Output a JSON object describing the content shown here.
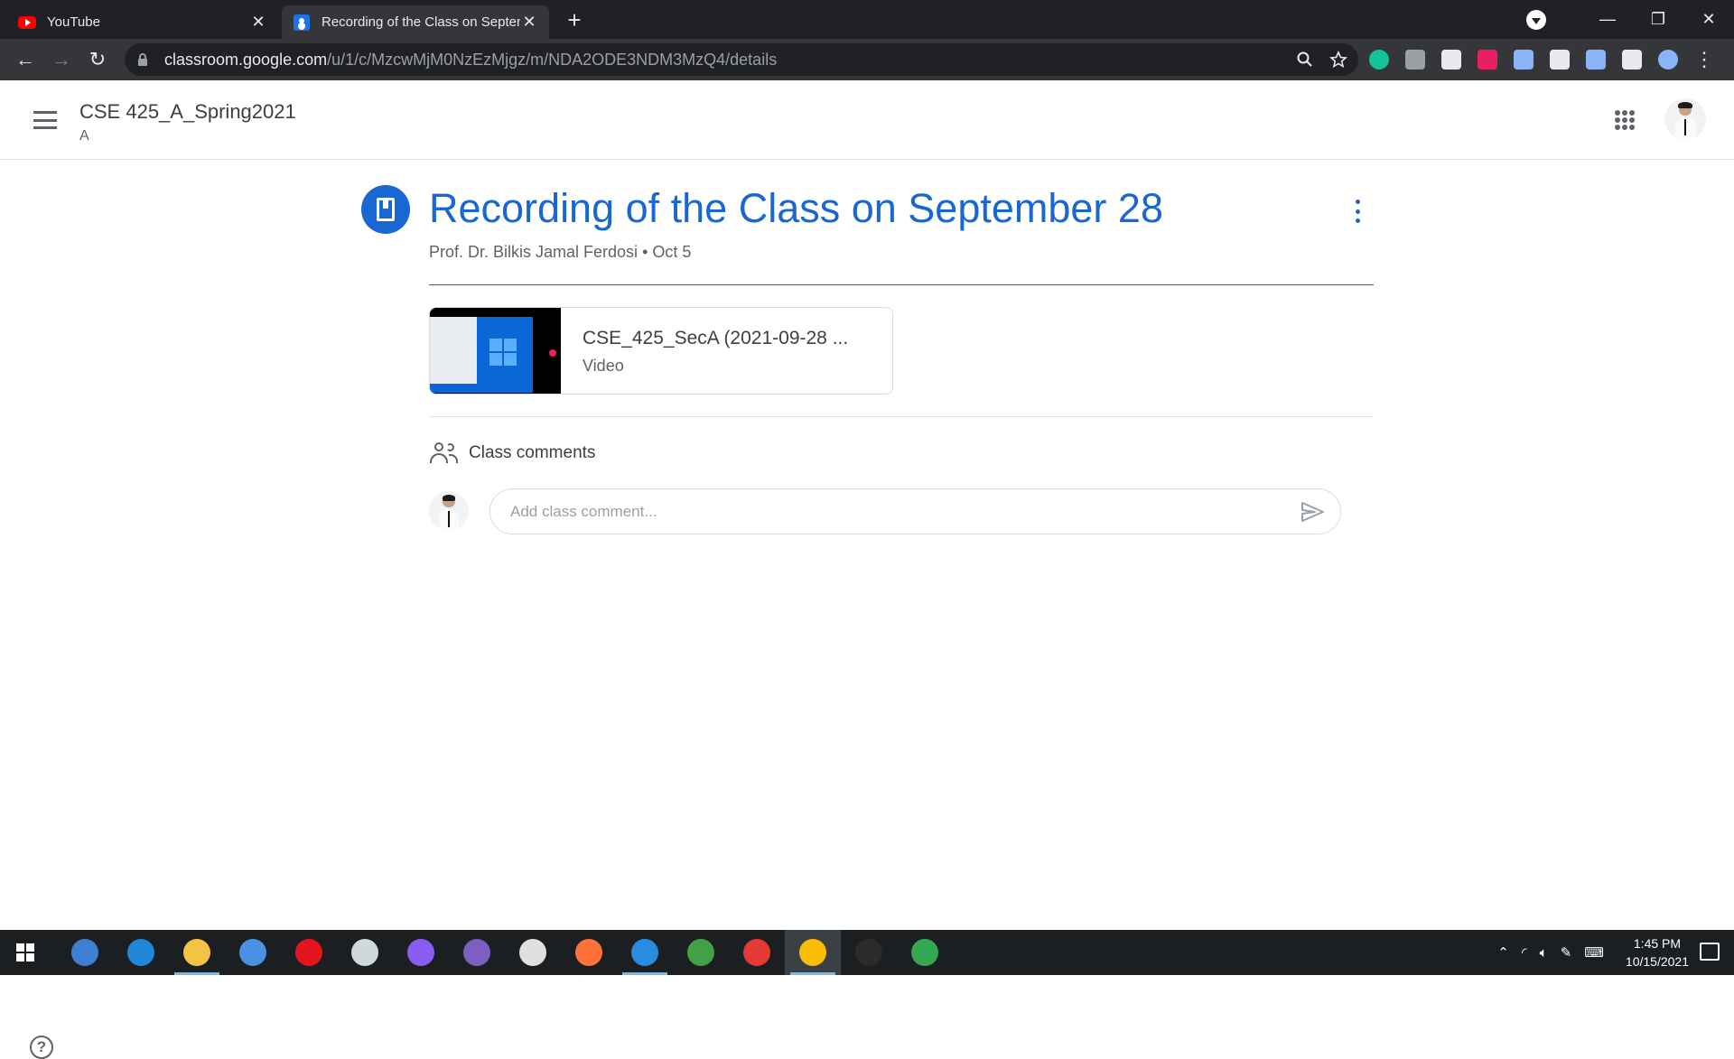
{
  "browser": {
    "tabs": [
      {
        "title": "YouTube",
        "active": false,
        "icon": "youtube-icon"
      },
      {
        "title": "Recording of the Class on Septem",
        "active": true,
        "icon": "google-classroom-icon"
      }
    ],
    "url_host": "classroom.google.com",
    "url_path": "/u/1/c/MzcwMjM0NzEzMjgz/m/NDA2ODE3NDM3MzQ4/details",
    "extension_colors": [
      "#15c39a",
      "#9aa0a6",
      "#e8eaed",
      "#e91e63",
      "#8ab4f8",
      "#e8eaed",
      "#8ab4f8",
      "#e8eaed"
    ]
  },
  "classroom": {
    "course_name": "CSE 425_A_Spring2021",
    "course_section": "A"
  },
  "post": {
    "title": "Recording of the Class on September 28",
    "author": "Prof. Dr. Bilkis Jamal Ferdosi",
    "separator": "•",
    "date": "Oct 5",
    "attachment": {
      "title": "CSE_425_SecA (2021-09-28 ...",
      "type": "Video"
    }
  },
  "comments": {
    "label": "Class comments",
    "placeholder": "Add class comment..."
  },
  "taskbar": {
    "time": "1:45 PM",
    "date": "10/15/2021",
    "apps": [
      {
        "name": "qbittorrent-icon",
        "color": "#3f7fd3",
        "running": false,
        "active": false
      },
      {
        "name": "edge-icon",
        "color": "#1f86d8",
        "running": false,
        "active": false
      },
      {
        "name": "file-explorer-icon",
        "color": "#f3c343",
        "running": true,
        "active": false
      },
      {
        "name": "mail-icon",
        "color": "#4a90e2",
        "running": false,
        "active": false
      },
      {
        "name": "opera-icon",
        "color": "#e3141e",
        "running": false,
        "active": false
      },
      {
        "name": "satellite-app-icon",
        "color": "#cfd8dc",
        "running": false,
        "active": false
      },
      {
        "name": "messenger-icon",
        "color": "#8a5cf6",
        "running": false,
        "active": false
      },
      {
        "name": "github-icon",
        "color": "#7b5fc4",
        "running": false,
        "active": false
      },
      {
        "name": "paint-icon",
        "color": "#e0e0e0",
        "running": false,
        "active": false
      },
      {
        "name": "firefox-icon",
        "color": "#ff7139",
        "running": false,
        "active": false
      },
      {
        "name": "vscode-icon",
        "color": "#2a8ce0",
        "running": true,
        "active": false
      },
      {
        "name": "globe-app-icon",
        "color": "#43a047",
        "running": false,
        "active": false
      },
      {
        "name": "chrome-icon",
        "color": "#e53935",
        "running": false,
        "active": false
      },
      {
        "name": "chrome-profile-icon",
        "color": "#fbbc04",
        "running": true,
        "active": true
      },
      {
        "name": "terminal-icon",
        "color": "#2b2b2b",
        "running": false,
        "active": false
      },
      {
        "name": "chrome-alt-icon",
        "color": "#34a853",
        "running": false,
        "active": false
      }
    ]
  }
}
